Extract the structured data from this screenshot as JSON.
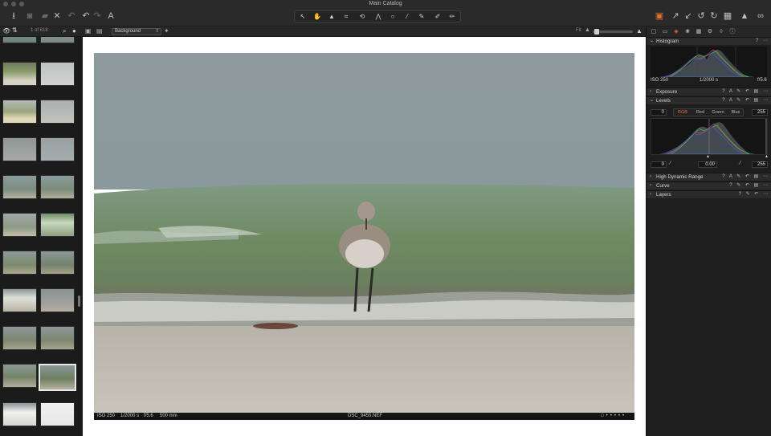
{
  "window": {
    "title": "Main Catalog"
  },
  "toolbar": {
    "left_icons": [
      "import-icon",
      "camera-icon",
      "folder-icon",
      "close-icon",
      "rotate-back-icon",
      "undo-icon",
      "redo-icon",
      "text-icon"
    ],
    "right_icons": [
      "layers-icon",
      "expand-icon",
      "compress-icon",
      "rotate-left-icon",
      "rotate-right-icon",
      "grid-icon",
      "warning-icon",
      "glasses-icon"
    ]
  },
  "browser": {
    "count": "1 of 618",
    "background_select": "Background"
  },
  "viewer": {
    "fit_label": "Fit",
    "photo_info": {
      "iso": "ISO 250",
      "shutter": "1/2000 s",
      "aperture": "f/5.6",
      "focal": "500 mm",
      "filename": "DSC_9455.NEF"
    }
  },
  "panel": {
    "histogram": {
      "label": "Histogram",
      "iso": "ISO 250",
      "shutter": "1/2000 s",
      "aperture": "f/5.6"
    },
    "exposure": {
      "label": "Exposure"
    },
    "levels": {
      "label": "Levels",
      "channels": [
        "RGB",
        "Red",
        "Green",
        "Blue"
      ],
      "active_channel": "RGB",
      "input_low": "0",
      "input_high": "255",
      "output_low": "0",
      "midpoint": "0.00",
      "output_high": "255"
    },
    "hdr": {
      "label": "High Dynamic Range"
    },
    "curve": {
      "label": "Curve"
    },
    "layers": {
      "label": "Layers"
    }
  },
  "colors": {
    "accent": "#e8702a",
    "panel_bg": "#1e1e1e",
    "toolbar_bg": "#2a2a2a"
  }
}
